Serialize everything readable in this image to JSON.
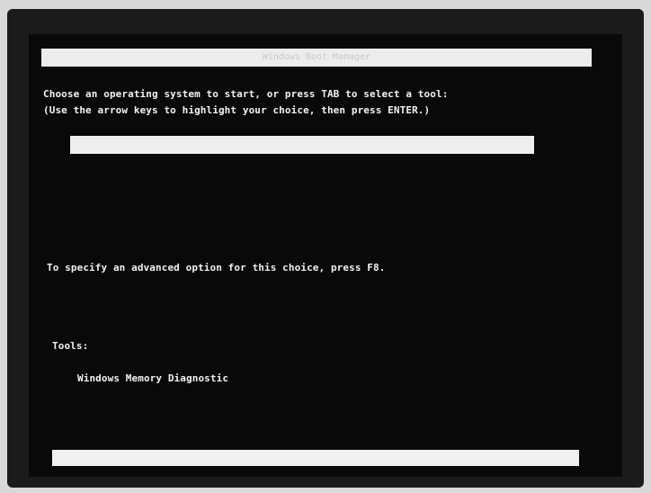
{
  "window": {
    "title": "Windows Boot Manager"
  },
  "instructions": {
    "line1": "Choose an operating system to start, or press TAB to select a tool:",
    "line2": "(Use the arrow keys to highlight your choice, then press ENTER.)"
  },
  "os_list": {
    "selected_item": ""
  },
  "advanced_hint": "To specify an advanced option for this choice, press F8.",
  "tools": {
    "heading": "Tools:",
    "items": [
      "Windows Memory Diagnostic"
    ]
  },
  "status_bar": {
    "text": ""
  }
}
